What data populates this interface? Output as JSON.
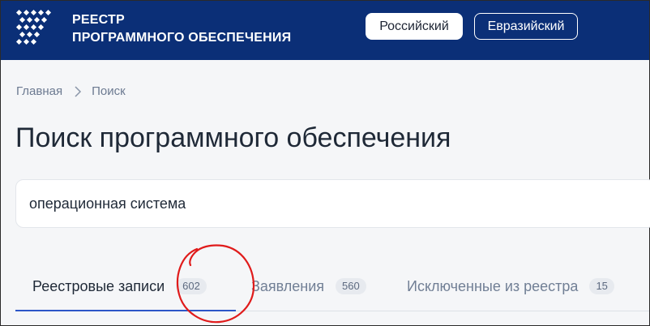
{
  "colors": {
    "header_bg": "#0b2f77",
    "page_bg": "#f5f6f8",
    "tab_active_underline": "#2d56c8",
    "annotation_circle": "#e01b1b"
  },
  "header": {
    "logo_icon": "diamond-grid-icon",
    "logo_line1": "РЕЕСТР",
    "logo_line2": "ПРОГРАММНОГО ОБЕСПЕЧЕНИЯ",
    "btn_russian": "Российский",
    "btn_eurasian": "Евразийский"
  },
  "breadcrumb": {
    "home": "Главная",
    "separator_icon": "chevron-right-icon",
    "current": "Поиск"
  },
  "page_title": "Поиск программного обеспечения",
  "search": {
    "value": "операционная система"
  },
  "tabs": [
    {
      "label": "Реестровые записи",
      "count": "602",
      "active": true
    },
    {
      "label": "Заявления",
      "count": "560",
      "active": false
    },
    {
      "label": "Исключенные из реестра",
      "count": "15",
      "active": false
    }
  ],
  "annotation": {
    "shape": "hand-drawn-circle-annotation",
    "target": "tab-count-badge-registry"
  }
}
